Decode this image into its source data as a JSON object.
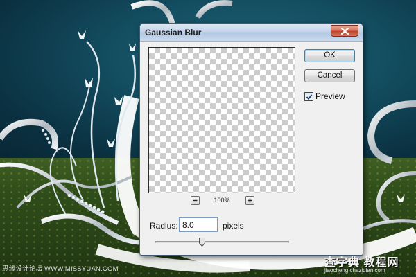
{
  "dialog": {
    "title": "Gaussian Blur",
    "ok_label": "OK",
    "cancel_label": "Cancel",
    "preview_label": "Preview",
    "preview_checked": true,
    "zoom_value": "100%",
    "radius_label": "Radius:",
    "radius_value": "8.0",
    "radius_unit": "pixels",
    "radius_slider_fraction": 0.35
  },
  "icons": {
    "close": "close-icon",
    "zoom_out": "minus-icon",
    "zoom_in": "plus-icon",
    "check": "checkmark-icon"
  },
  "watermarks": {
    "left": "思缘设计论坛 WWW.MISSYUAN.COM",
    "right_logo": "查字典 教程网",
    "right_url": "jiaocheng.chazidian.com"
  },
  "colors": {
    "sky": "#0d3a4a",
    "grass": "#2f4d1a",
    "dialog_bg": "#f0f0f0",
    "close_red": "#c0452a"
  }
}
